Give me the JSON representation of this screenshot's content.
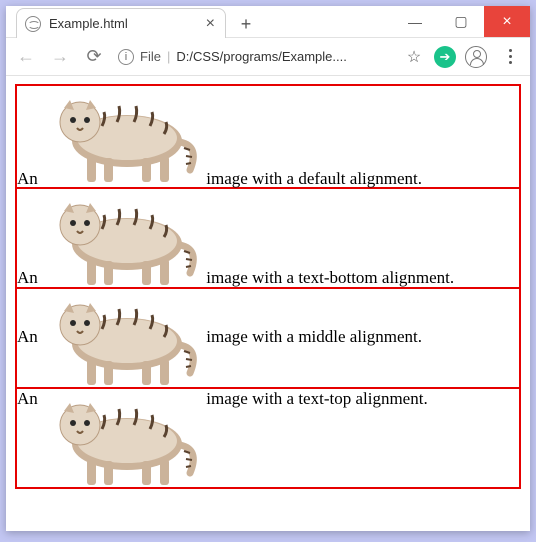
{
  "window": {
    "tab_title": "Example.html"
  },
  "addressbar": {
    "scheme_label": "File",
    "path": "D:/CSS/programs/Example...."
  },
  "examples": [
    {
      "pre": "An",
      "post": "image with a default alignment.",
      "valign": "baseline"
    },
    {
      "pre": "An",
      "post": "image with a text-bottom alignment.",
      "valign": "text-bottom"
    },
    {
      "pre": "An",
      "post": "image with a middle alignment.",
      "valign": "middle"
    },
    {
      "pre": "An",
      "post": "image with a text-top alignment.",
      "valign": "text-top"
    }
  ]
}
